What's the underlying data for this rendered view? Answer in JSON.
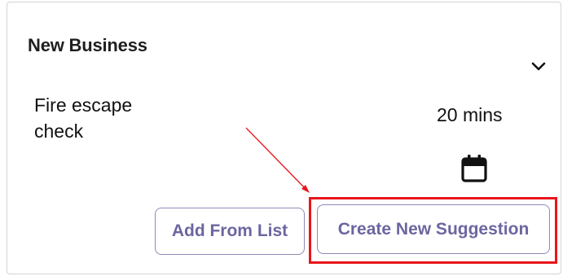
{
  "card": {
    "title": "New Business",
    "task": {
      "name": "Fire escape check",
      "duration": "20 mins"
    },
    "buttons": {
      "add_from_list": "Add From List",
      "create_new_suggestion": "Create New Suggestion"
    }
  },
  "icons": {
    "expand": "chevron-down-icon",
    "date": "calendar-icon"
  },
  "colors": {
    "button_border": "#8d8ab8",
    "button_text": "#6b66a0",
    "annotation": "#e8161b"
  }
}
